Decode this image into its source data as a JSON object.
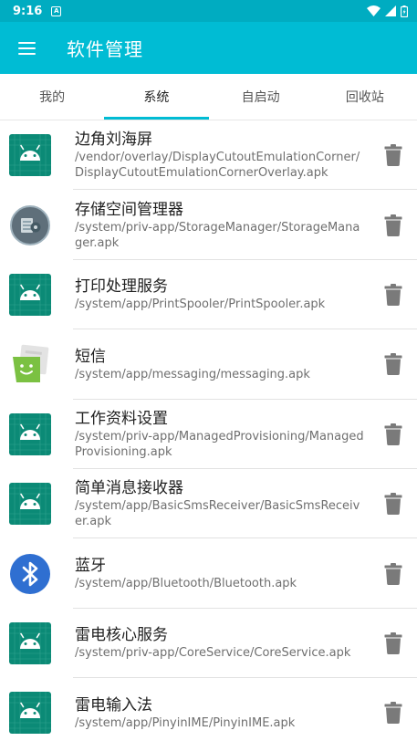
{
  "status_bar": {
    "time": "9:16",
    "notification_glyph": "A"
  },
  "app_bar": {
    "title": "软件管理",
    "menu_icon": "menu-icon"
  },
  "tabs": [
    {
      "label": "我的",
      "active": false
    },
    {
      "label": "系统",
      "active": true
    },
    {
      "label": "自启动",
      "active": false
    },
    {
      "label": "回收站",
      "active": false
    }
  ],
  "apps": [
    {
      "name": "边角刘海屏",
      "path": "/vendor/overlay/DisplayCutoutEmulationCorner/DisplayCutoutEmulationCornerOverlay.apk",
      "icon": "android-icon"
    },
    {
      "name": "存储空间管理器",
      "path": "/system/priv-app/StorageManager/StorageManager.apk",
      "icon": "storage-icon"
    },
    {
      "name": "打印处理服务",
      "path": "/system/app/PrintSpooler/PrintSpooler.apk",
      "icon": "android-icon"
    },
    {
      "name": "短信",
      "path": "/system/app/messaging/messaging.apk",
      "icon": "messaging-icon"
    },
    {
      "name": "工作资料设置",
      "path": "/system/priv-app/ManagedProvisioning/ManagedProvisioning.apk",
      "icon": "android-icon"
    },
    {
      "name": "简单消息接收器",
      "path": "/system/app/BasicSmsReceiver/BasicSmsReceiver.apk",
      "icon": "android-icon"
    },
    {
      "name": "蓝牙",
      "path": "/system/app/Bluetooth/Bluetooth.apk",
      "icon": "bluetooth-icon"
    },
    {
      "name": "雷电核心服务",
      "path": "/system/priv-app/CoreService/CoreService.apk",
      "icon": "android-icon"
    },
    {
      "name": "雷电输入法",
      "path": "/system/app/PinyinIME/PinyinIME.apk",
      "icon": "android-icon"
    }
  ],
  "colors": {
    "primary": "#00bcd4",
    "status_bar": "#00acc1",
    "android_tile": "#0b8a76",
    "delete_icon": "#7a7a7a",
    "bluetooth": "#2f6fd1"
  }
}
